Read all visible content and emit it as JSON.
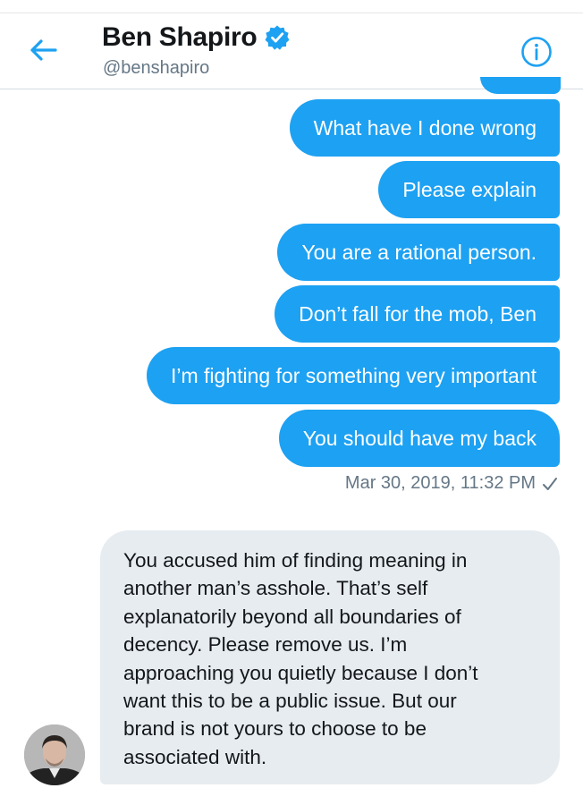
{
  "header": {
    "display_name": "Ben Shapiro",
    "handle": "@benshapiro",
    "back_icon": "arrow-left-icon",
    "verified_icon": "verified-badge-icon",
    "info_icon": "info-circle-icon"
  },
  "colors": {
    "accent": "#1da1f2",
    "incoming_bubble": "#e6ecf0",
    "secondary_text": "#657786",
    "primary_text": "#14171a"
  },
  "messages_out": [
    "What have I done wrong",
    "Please explain",
    "You are a rational person.",
    "Don’t fall for the mob, Ben",
    "I’m fighting for something very important",
    "You should have my back"
  ],
  "timestamp": "Mar 30, 2019, 11:32 PM",
  "timestamp_icon": "sent-check-icon",
  "message_in": {
    "lines": [
      "You accused him of finding meaning in",
      "another man’s asshole. That’s self",
      "explanatorily beyond all boundaries of",
      "decency. Please remove us. I’m",
      "approaching you quietly because I don’t",
      "want this to be a public issue. But our",
      "brand is not yours to choose to be",
      "associated with."
    ],
    "avatar_icon": "user-avatar"
  }
}
